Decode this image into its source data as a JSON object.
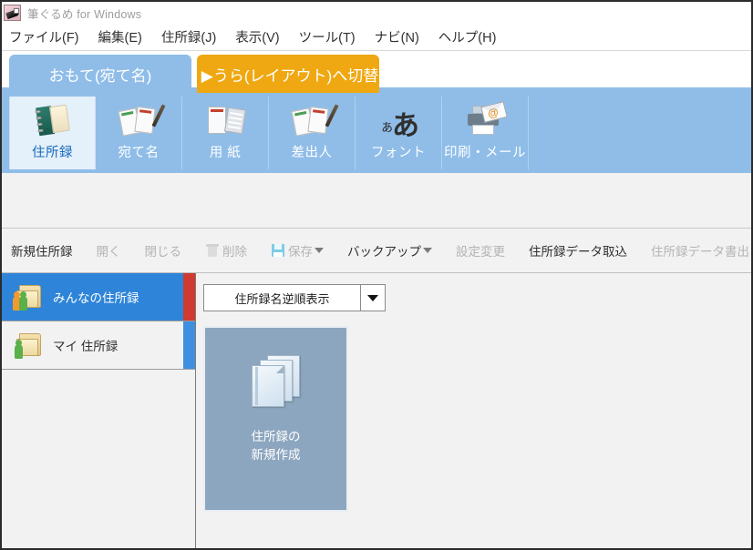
{
  "window": {
    "title": "筆ぐるめ for Windows",
    "app_icon": "brush-icon",
    "border_color": "#2b2b2b"
  },
  "menubar": {
    "items": [
      {
        "label": "ファイル(F)"
      },
      {
        "label": "編集(E)"
      },
      {
        "label": "住所録(J)"
      },
      {
        "label": "表示(V)"
      },
      {
        "label": "ツール(T)"
      },
      {
        "label": "ナビ(N)"
      },
      {
        "label": "ヘルプ(H)"
      }
    ]
  },
  "side_tabs": {
    "front": {
      "label": "おもて(宛て名)",
      "color": "#8fbde8",
      "active": true
    },
    "back": {
      "label": "▶うら(レイアウト)へ切替",
      "color": "#efa812",
      "active": false
    }
  },
  "icon_toolbar": {
    "background": "#8fbde8",
    "active_background": "#e4f0fa",
    "active_text": "#1769bb",
    "buttons": [
      {
        "label": "住所録",
        "icon": "address-book-icon",
        "active": true
      },
      {
        "label": "宛て名",
        "icon": "postcards-pen-icon",
        "active": false
      },
      {
        "label": "用 紙",
        "icon": "paper-label-icon",
        "active": false
      },
      {
        "label": "差出人",
        "icon": "sender-cards-icon",
        "active": false
      },
      {
        "label": "フォント",
        "icon": "font-icon",
        "glyph_small": "ぁ",
        "glyph_big": "あ",
        "active": false
      },
      {
        "label": "印刷・メール",
        "icon": "printer-mail-icon",
        "active": false
      }
    ]
  },
  "command_bar": {
    "commands": [
      {
        "label": "新規住所録",
        "enabled": true,
        "icon": null,
        "dropdown": false
      },
      {
        "label": "開く",
        "enabled": false,
        "icon": null,
        "dropdown": false
      },
      {
        "label": "閉じる",
        "enabled": false,
        "icon": null,
        "dropdown": false
      },
      {
        "label": "削除",
        "enabled": false,
        "icon": "trash-icon",
        "dropdown": false
      },
      {
        "label": "保存",
        "enabled": false,
        "icon": "save-icon",
        "dropdown": true
      },
      {
        "label": "バックアップ",
        "enabled": true,
        "icon": null,
        "dropdown": true
      },
      {
        "label": "設定変更",
        "enabled": false,
        "icon": null,
        "dropdown": false
      },
      {
        "label": "住所録データ取込",
        "enabled": true,
        "icon": null,
        "dropdown": false
      },
      {
        "label": "住所録データ書出",
        "enabled": false,
        "icon": null,
        "dropdown": false
      }
    ]
  },
  "sidebar": {
    "items": [
      {
        "label": "みんなの住所録",
        "icon": "shared-folder-icon",
        "selected": true,
        "edge_color": "#d03a30"
      },
      {
        "label": "マイ 住所録",
        "icon": "my-folder-icon",
        "selected": false,
        "edge_color": "#3f8fe0"
      }
    ]
  },
  "content": {
    "sort_select": {
      "value": "住所録名逆順表示",
      "arrow": "chevron-down-icon"
    },
    "new_tile": {
      "caption": "住所録の\n新規作成",
      "icon": "stacked-documents-icon",
      "background": "#8da6bf"
    }
  }
}
